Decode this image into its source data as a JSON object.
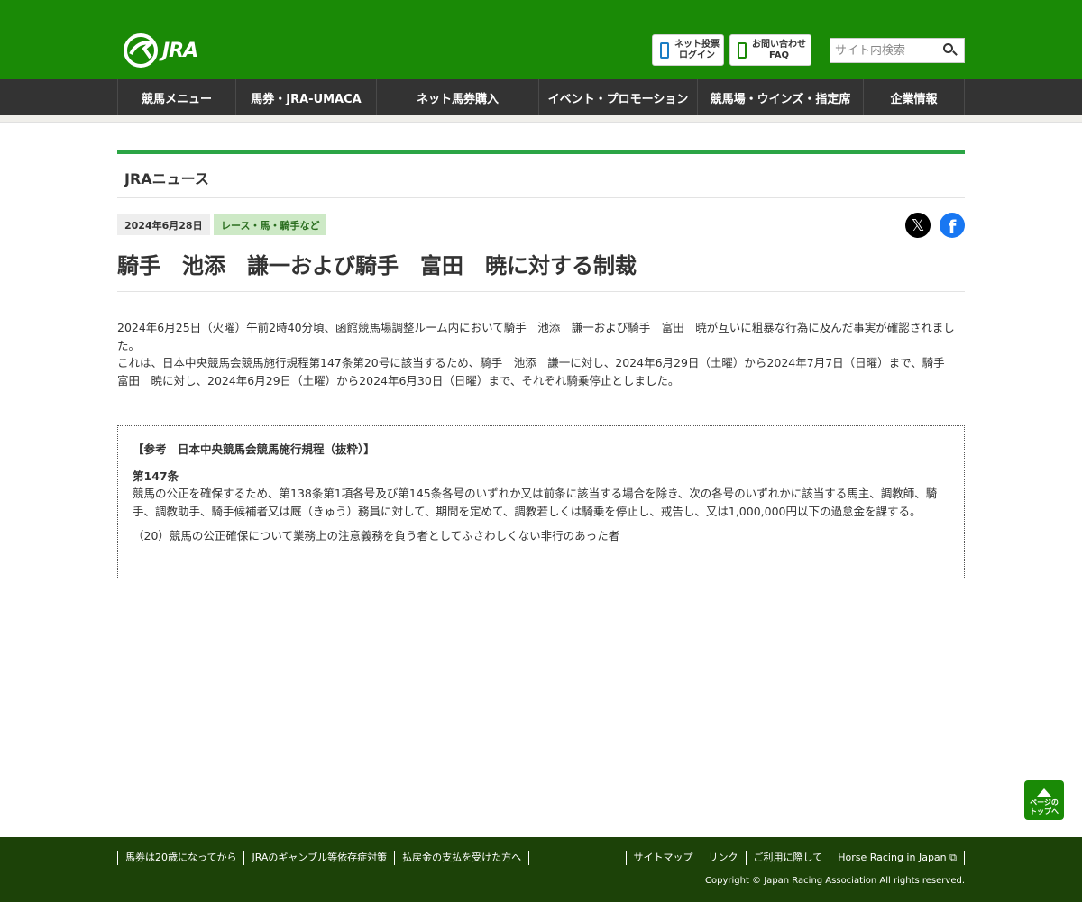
{
  "header": {
    "logo_text": "JRA",
    "login_button": {
      "line1": "ネット投票",
      "line2": "ログイン"
    },
    "faq_button": {
      "line1": "お問い合わせ",
      "line2": "FAQ"
    },
    "search": {
      "placeholder": "サイト内検索"
    }
  },
  "nav": {
    "items": [
      {
        "label": "競馬メニュー"
      },
      {
        "label": "馬券・JRA-UMACA"
      },
      {
        "label": "ネット馬券購入"
      },
      {
        "label": "イベント・プロモーション"
      },
      {
        "label": "競馬場・ウインズ・指定席"
      },
      {
        "label": "企業情報"
      }
    ]
  },
  "section": {
    "title": "JRAニュース"
  },
  "article": {
    "date": "2024年6月28日",
    "category": "レース・馬・騎手など",
    "title": "騎手　池添　謙一および騎手　富田　暁に対する制裁",
    "paragraph1": "2024年6月25日（火曜）午前2時40分頃、函館競馬場調整ルーム内において騎手　池添　謙一および騎手　富田　暁が互いに粗暴な行為に及んだ事実が確認されました。",
    "paragraph2": "これは、日本中央競馬会競馬施行規程第147条第20号に該当するため、騎手　池添　謙一に対し、2024年6月29日（土曜）から2024年7月7日（日曜）まで、騎手　富田　暁に対し、2024年6月29日（土曜）から2024年6月30日（日曜）まで、それぞれ騎乗停止としました。"
  },
  "reference": {
    "heading": "【参考　日本中央競馬会競馬施行規程（抜粋）】",
    "article_no": "第147条",
    "text": "競馬の公正を確保するため、第138条第1項各号及び第145条各号のいずれか又は前条に該当する場合を除き、次の各号のいずれかに該当する馬主、調教師、騎手、調教助手、騎手候補者又は厩（きゅう）務員に対して、期間を定めて、調教若しくは騎乗を停止し、戒告し、又は1,000,000円以下の過怠金を課する。",
    "item": "（20）競馬の公正確保について業務上の注意義務を負う者としてふさわしくない非行のあった者"
  },
  "page_top": {
    "line1": "ページの",
    "line2": "トップへ"
  },
  "footer": {
    "left_links": [
      {
        "label": "馬券は20歳になってから"
      },
      {
        "label": "JRAのギャンブル等依存症対策"
      },
      {
        "label": "払戻金の支払を受けた方へ"
      }
    ],
    "right_links": [
      {
        "label": "サイトマップ"
      },
      {
        "label": "リンク"
      },
      {
        "label": "ご利用に際して"
      },
      {
        "label": "Horse Racing in Japan ⧉"
      }
    ],
    "copyright": "Copyright © Japan Racing Association All rights reserved."
  },
  "colors": {
    "header_green": "#1a8a06",
    "nav_dark": "#333333",
    "section_bar": "#2ba545",
    "footer_green": "#1c4208",
    "category_bg": "#cde9c6"
  }
}
